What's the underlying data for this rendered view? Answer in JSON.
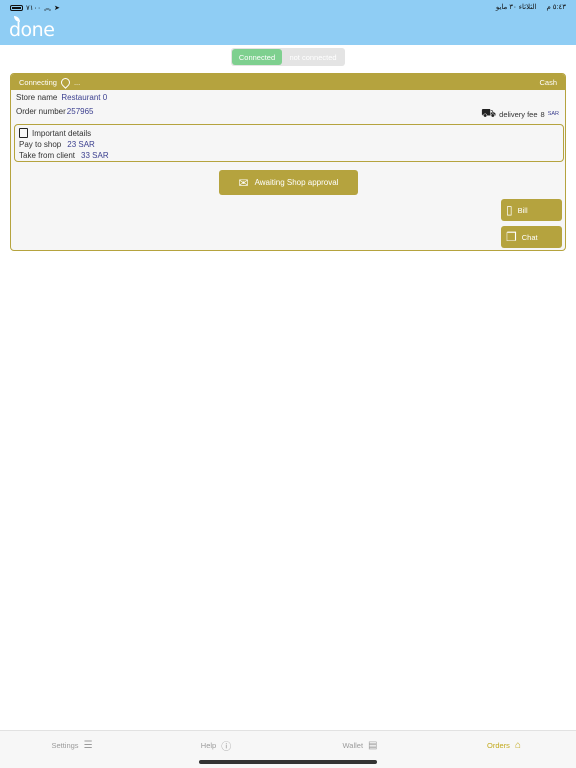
{
  "status_bar": {
    "left_text": "٧١٠٠",
    "time": "٥:٤٣ م",
    "date": "الثلاثاء ٣٠ مايو"
  },
  "header": {
    "logo_text": "done"
  },
  "connection_toggle": {
    "options": [
      "Connected",
      "not connected"
    ],
    "selected": "Connected",
    "connected_color": "#7ed08f"
  },
  "order": {
    "header_left": "Connecting",
    "header_status": "...",
    "payment_method": "Cash",
    "store_name_label": "Store name",
    "store_name": "Restaurant 0",
    "order_number_label": "Order number",
    "order_number": "257965",
    "delivery_fee_label": "delivery fee",
    "delivery_fee_value": "8",
    "delivery_fee_unit": "SAR",
    "details_title": "Important details",
    "pay_to_shop_label": "Pay to shop",
    "pay_to_shop_value": "23 SAR",
    "take_from_client_label": "Take from client",
    "take_from_client_value": "33 SAR",
    "status_button": "Awaiting Shop approval",
    "bill_button": "Bill",
    "chat_button": "Chat"
  },
  "tabbar": {
    "settings": "Settings",
    "help": "Help",
    "wallet": "Wallet",
    "orders": "Orders",
    "active": "Orders"
  },
  "colors": {
    "accent": "#b5a33e",
    "header_bg": "#8fcdf4",
    "tab_active": "#c2a91c",
    "value_text": "#3b3f8f"
  },
  "icons": {
    "settings": "sliders-icon",
    "help": "info-icon",
    "wallet": "wallet-icon",
    "orders": "home-icon",
    "delivery": "truck-icon",
    "bill": "receipt-icon",
    "chat": "chat-bubbles-icon",
    "status": "envelope-check-icon",
    "location": "location-pin-icon"
  }
}
